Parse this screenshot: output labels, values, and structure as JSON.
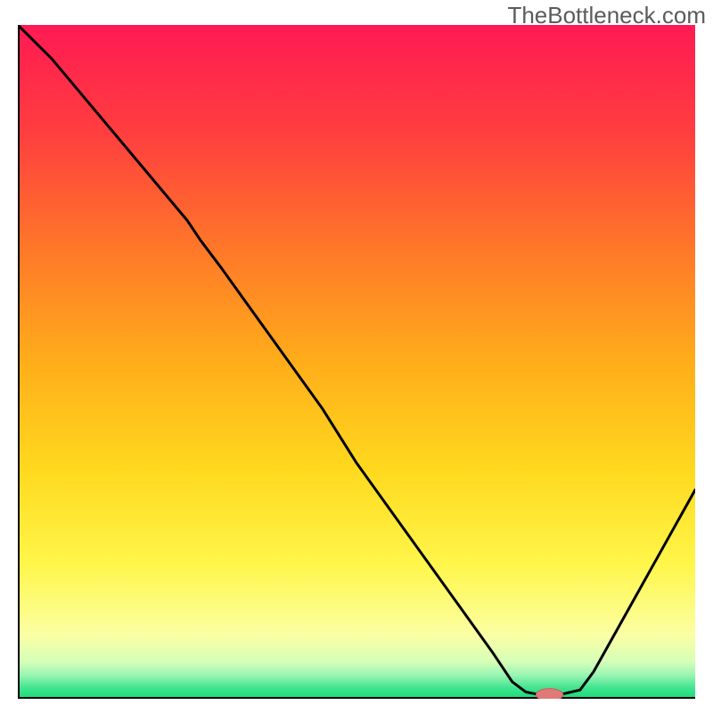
{
  "watermark": "TheBottleneck.com",
  "colors": {
    "gradient_stops": [
      {
        "offset": 0.0,
        "color": "#ff1a53"
      },
      {
        "offset": 0.16,
        "color": "#ff3e3f"
      },
      {
        "offset": 0.34,
        "color": "#ff7a28"
      },
      {
        "offset": 0.5,
        "color": "#ffad1a"
      },
      {
        "offset": 0.66,
        "color": "#ffd91e"
      },
      {
        "offset": 0.8,
        "color": "#fff64a"
      },
      {
        "offset": 0.905,
        "color": "#fbffa3"
      },
      {
        "offset": 0.945,
        "color": "#d6ffb8"
      },
      {
        "offset": 0.965,
        "color": "#99f5b3"
      },
      {
        "offset": 0.985,
        "color": "#3de38d"
      },
      {
        "offset": 1.0,
        "color": "#19db78"
      }
    ],
    "axis": "#000000",
    "line": "#000000",
    "marker_fill": "#e07a78",
    "marker_stroke": "#c85f5e"
  },
  "chart_data": {
    "type": "line",
    "title": "",
    "xlabel": "",
    "ylabel": "",
    "xlim": [
      0,
      100
    ],
    "ylim": [
      0,
      100
    ],
    "notes": "Single-series curve estimated from pixels. y ≈ bottleneck percentage (0 at bottom). Marker at curve minimum.",
    "x": [
      0,
      5,
      10,
      15,
      20,
      25,
      27,
      30,
      35,
      40,
      45,
      50,
      55,
      60,
      65,
      70,
      73,
      75,
      77,
      80,
      83,
      85,
      90,
      95,
      100
    ],
    "y": [
      100,
      95,
      89,
      83,
      77,
      71,
      68,
      64,
      57,
      50,
      43,
      35,
      28,
      21,
      14,
      7,
      2.5,
      1.0,
      0.6,
      0.6,
      1.3,
      4,
      13,
      22,
      31
    ],
    "marker": {
      "x": 78.5,
      "y": 0.6,
      "rx_pct": 2.0,
      "ry_pct": 0.9
    }
  }
}
